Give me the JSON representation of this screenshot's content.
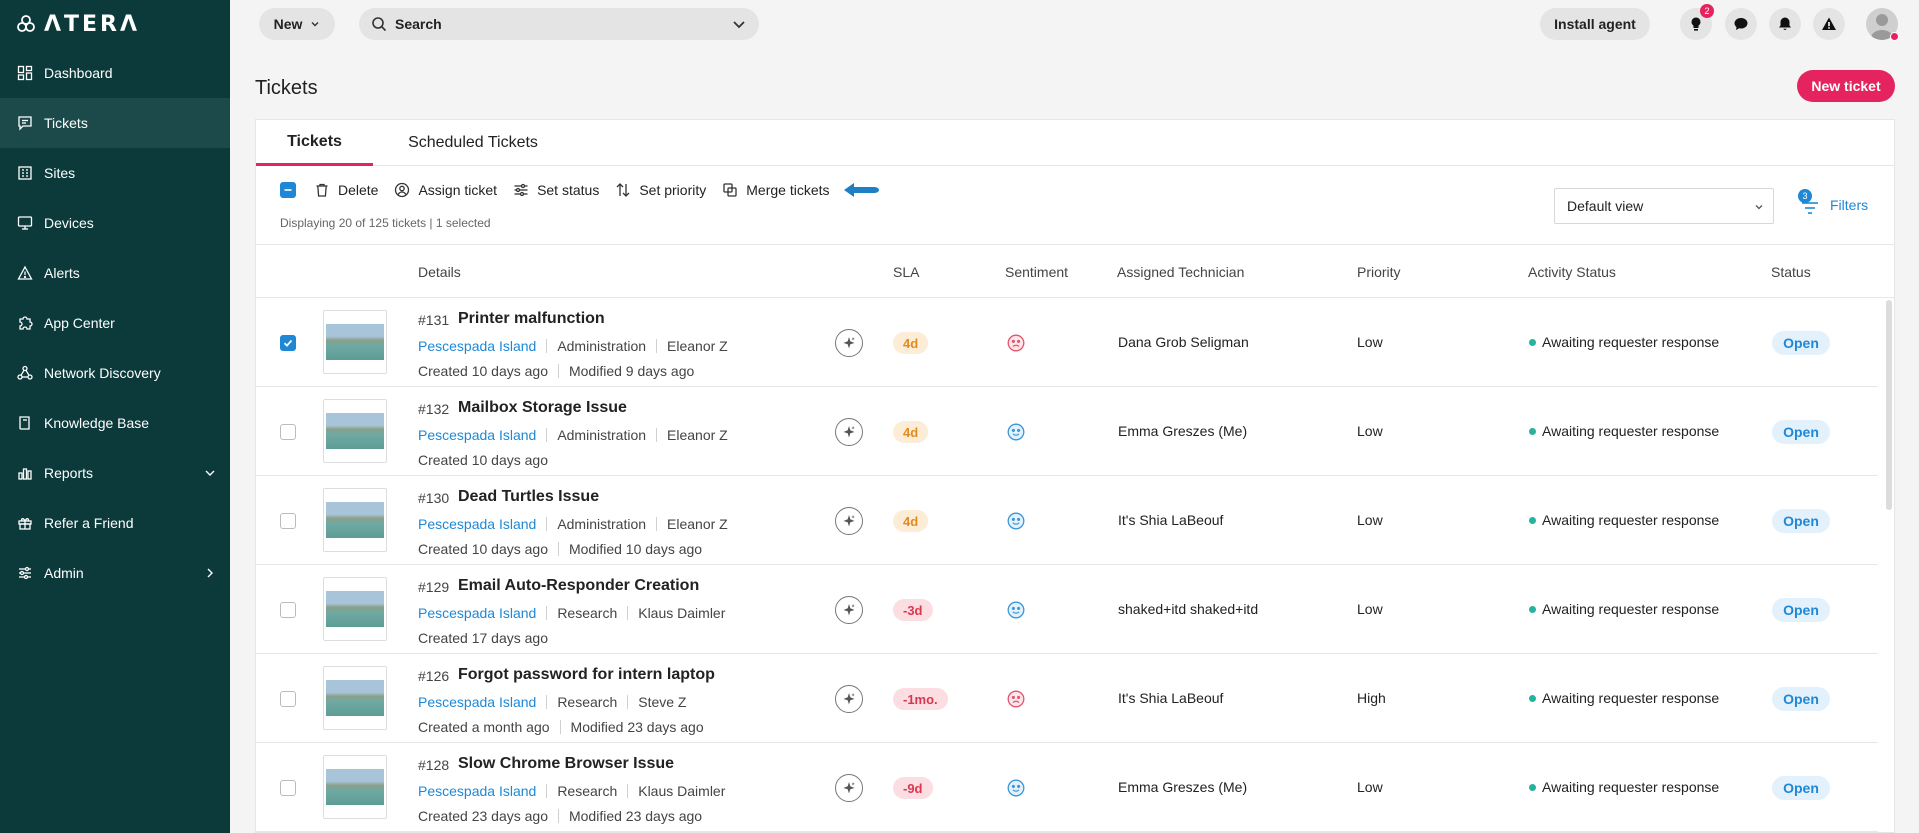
{
  "brand": {
    "logo_text": "ΛTERΛ"
  },
  "sidebar": {
    "items": [
      {
        "label": "Dashboard",
        "icon": "dashboard-icon"
      },
      {
        "label": "Tickets",
        "icon": "ticket-icon",
        "active": true
      },
      {
        "label": "Sites",
        "icon": "building-icon"
      },
      {
        "label": "Devices",
        "icon": "monitor-icon"
      },
      {
        "label": "Alerts",
        "icon": "alert-icon"
      },
      {
        "label": "App Center",
        "icon": "puzzle-icon"
      },
      {
        "label": "Network Discovery",
        "icon": "network-icon"
      },
      {
        "label": "Knowledge Base",
        "icon": "book-icon"
      },
      {
        "label": "Reports",
        "icon": "chart-icon"
      },
      {
        "label": "Refer a Friend",
        "icon": "gift-icon"
      },
      {
        "label": "Admin",
        "icon": "sliders-icon"
      }
    ]
  },
  "topbar": {
    "new_label": "New",
    "search_placeholder": "Search",
    "install_label": "Install agent",
    "notification_count": "2"
  },
  "page": {
    "title": "Tickets",
    "new_ticket_label": "New ticket"
  },
  "tabs": [
    {
      "label": "Tickets",
      "active": true
    },
    {
      "label": "Scheduled Tickets",
      "active": false
    }
  ],
  "toolbar": {
    "delete": "Delete",
    "assign": "Assign ticket",
    "status": "Set status",
    "priority": "Set priority",
    "merge": "Merge tickets",
    "displaying": "Displaying 20 of 125 tickets | 1 selected",
    "view": "Default view",
    "filters": "Filters",
    "filters_count": "3"
  },
  "columns": {
    "details": "Details",
    "sla": "SLA",
    "sentiment": "Sentiment",
    "tech": "Assigned Technician",
    "priority": "Priority",
    "activity": "Activity Status",
    "status": "Status"
  },
  "rows": [
    {
      "num": "#131",
      "title": "Printer malfunction",
      "site": "Pescespada Island",
      "dept": "Administration",
      "person": "Eleanor Z",
      "created": "Created 10 days ago",
      "modified": "Modified 9 days ago",
      "sla": "4d",
      "sla_type": "warn",
      "sentiment": "sad",
      "tech": "Dana Grob Seligman",
      "priority": "Low",
      "activity": "Awaiting requester response",
      "status": "Open",
      "checked": true
    },
    {
      "num": "#132",
      "title": "Mailbox Storage Issue",
      "site": "Pescespada Island",
      "dept": "Administration",
      "person": "Eleanor Z",
      "created": "Created 10 days ago",
      "modified": "",
      "sla": "4d",
      "sla_type": "warn",
      "sentiment": "happy",
      "tech": "Emma Greszes (Me)",
      "priority": "Low",
      "activity": "Awaiting requester response",
      "status": "Open",
      "checked": false
    },
    {
      "num": "#130",
      "title": "Dead Turtles Issue",
      "site": "Pescespada Island",
      "dept": "Administration",
      "person": "Eleanor Z",
      "created": "Created 10 days ago",
      "modified": "Modified 10 days ago",
      "sla": "4d",
      "sla_type": "warn",
      "sentiment": "happy",
      "tech": "It's Shia LaBeouf",
      "priority": "Low",
      "activity": "Awaiting requester response",
      "status": "Open",
      "checked": false
    },
    {
      "num": "#129",
      "title": "Email Auto-Responder Creation",
      "site": "Pescespada Island",
      "dept": "Research",
      "person": "Klaus Daimler",
      "created": "Created 17 days ago",
      "modified": "",
      "sla": "-3d",
      "sla_type": "bad",
      "sentiment": "happy",
      "tech": "shaked+itd shaked+itd",
      "priority": "Low",
      "activity": "Awaiting requester response",
      "status": "Open",
      "checked": false
    },
    {
      "num": "#126",
      "title": "Forgot password for intern laptop",
      "site": "Pescespada Island",
      "dept": "Research",
      "person": "Steve Z",
      "created": "Created a month ago",
      "modified": "Modified 23 days ago",
      "sla": "-1mo.",
      "sla_type": "bad",
      "sentiment": "sad",
      "tech": "It's Shia LaBeouf",
      "priority": "High",
      "activity": "Awaiting requester response",
      "status": "Open",
      "checked": false
    },
    {
      "num": "#128",
      "title": "Slow Chrome Browser Issue",
      "site": "Pescespada Island",
      "dept": "Research",
      "person": "Klaus Daimler",
      "created": "Created 23 days ago",
      "modified": "Modified 23 days ago",
      "sla": "-9d",
      "sla_type": "bad",
      "sentiment": "happy",
      "tech": "Emma Greszes (Me)",
      "priority": "Low",
      "activity": "Awaiting requester response",
      "status": "Open",
      "checked": false
    }
  ],
  "colors": {
    "sidebar": "#0c3a3a",
    "accent": "#e5245f",
    "link": "#1e88d6",
    "sla_warn": "#e58a1e",
    "sla_bad": "#d8384f"
  }
}
